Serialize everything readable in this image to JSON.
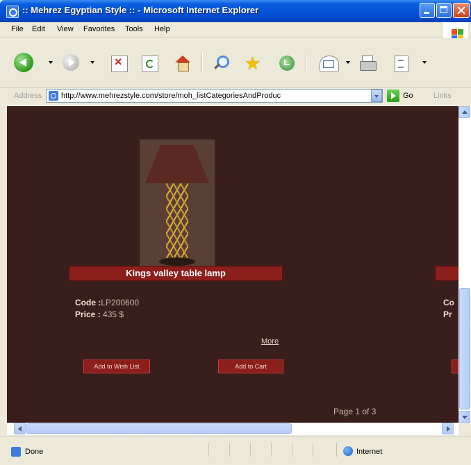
{
  "window": {
    "title": ":: Mehrez Egyptian Style :: - Microsoft Internet Explorer"
  },
  "menu": [
    "File",
    "Edit",
    "View",
    "Favorites",
    "Tools",
    "Help"
  ],
  "address": {
    "label": "Address",
    "url": "http://www.mehrezstyle.com/store/moh_listCategoriesAndProduc",
    "go_label": "Go",
    "links_label": "Links"
  },
  "product": {
    "name": "Kings valley table lamp",
    "code_label": "Code :",
    "code": "LP200600",
    "price_label": "Price :",
    "price": "435 $",
    "more_label": "More",
    "wishlist_label": "Add to Wish List",
    "cart_label": "Add to Cart",
    "image_icon": "table-lamp"
  },
  "partial_product": {
    "code_label": "Co",
    "price_label": "Pr"
  },
  "pagination": {
    "text": "Page 1 of 3"
  },
  "status": {
    "text": "Done",
    "zone": "Internet"
  },
  "colors": {
    "content_bg": "#3a1e1c",
    "accent_red": "#8c1e1c",
    "title_blue": "#0552d8"
  }
}
